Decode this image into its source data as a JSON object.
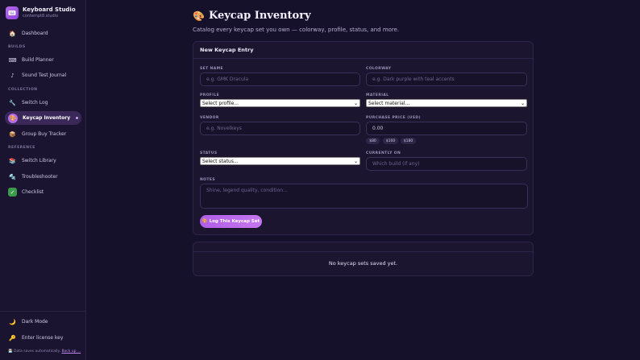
{
  "brand": {
    "title": "Keyboard Studio",
    "subtitle": "contempt8.studio"
  },
  "nav": {
    "dashboard": "Dashboard",
    "builds_label": "BUILDS",
    "build_planner": "Build Planner",
    "sound_test": "Sound Test Journal",
    "collection_label": "COLLECTION",
    "switch_log": "Switch Log",
    "keycap_inventory": "Keycap Inventory",
    "group_buy": "Group Buy Tracker",
    "reference_label": "REFERENCE",
    "switch_library": "Switch Library",
    "troubleshooter": "Troubleshooter",
    "checklist": "Checklist",
    "dark_mode": "Dark Mode",
    "license": "Enter license key"
  },
  "footer": {
    "note": "Data saves automatically.",
    "link": "Back up ..."
  },
  "page": {
    "emoji": "🎨",
    "title": "Keycap Inventory",
    "subtitle": "Catalog every keycap set you own — colorway, profile, status, and more."
  },
  "form": {
    "heading": "New Keycap Entry",
    "set_name_label": "SET NAME",
    "set_name_placeholder": "e.g. GMK Dracula",
    "colorway_label": "COLORWAY",
    "colorway_placeholder": "e.g. Dark purple with teal accents",
    "profile_label": "PROFILE",
    "profile_value": "Select profile...",
    "material_label": "MATERIAL",
    "material_value": "Select material...",
    "vendor_label": "VENDOR",
    "vendor_placeholder": "e.g. Novelkeys",
    "price_label": "PURCHASE PRICE (USD)",
    "price_value": "0.00",
    "chips": [
      "$80",
      "$100",
      "$180"
    ],
    "status_label": "STATUS",
    "status_value": "Select status...",
    "currently_on_label": "CURRENTLY ON",
    "currently_on_placeholder": "Which build (if any)",
    "notes_label": "NOTES",
    "notes_placeholder": "Shine, legend quality, condition...",
    "submit": "🎨 Log This Keycap Set"
  },
  "list": {
    "empty": "No keycap sets saved yet."
  },
  "colors": {
    "accent": "#b86bf0",
    "background": "#16112a",
    "sidebar": "#1a1430"
  }
}
